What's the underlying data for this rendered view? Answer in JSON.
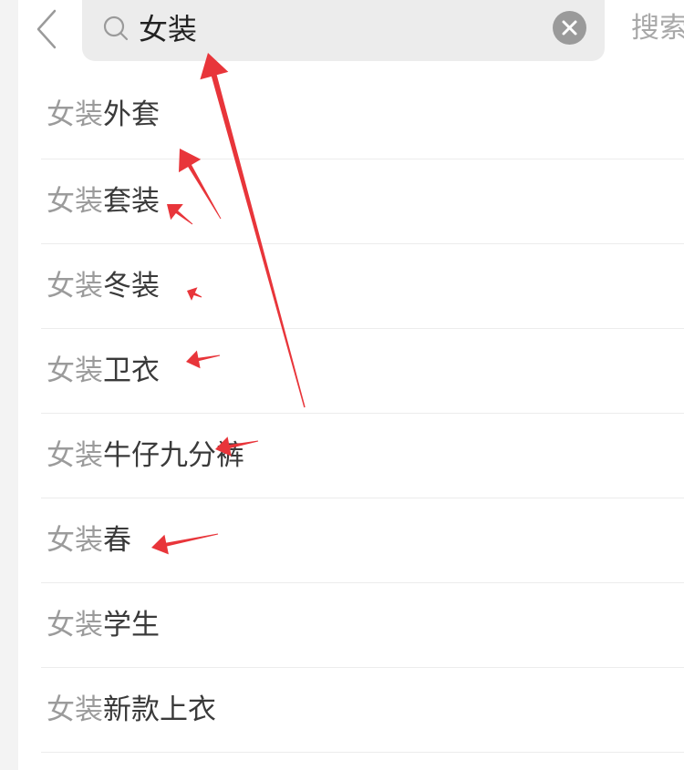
{
  "header": {
    "back_icon": "chevron-left-icon",
    "search": {
      "icon": "search-icon",
      "value": "女装",
      "clear_icon": "clear-icon"
    },
    "search_button_label": "搜索"
  },
  "suggestions": [
    {
      "keyword": "女装",
      "rest": "外套"
    },
    {
      "keyword": "女装",
      "rest": "套装"
    },
    {
      "keyword": "女装",
      "rest": "冬装"
    },
    {
      "keyword": "女装",
      "rest": "卫衣"
    },
    {
      "keyword": "女装",
      "rest": "牛仔九分裤"
    },
    {
      "keyword": "女装",
      "rest": "春"
    },
    {
      "keyword": "女装",
      "rest": "学生"
    },
    {
      "keyword": "女装",
      "rest": "新款上衣"
    }
  ],
  "annotation_color": "#e8353a"
}
